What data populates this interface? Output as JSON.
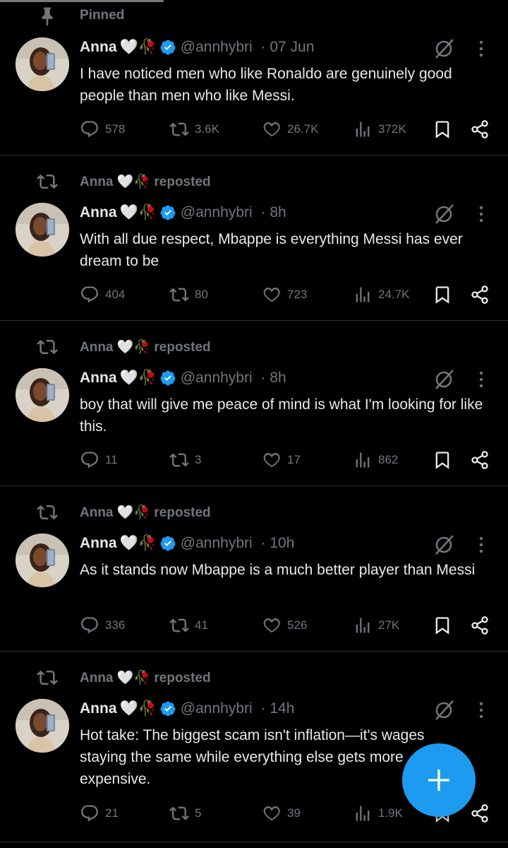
{
  "colors": {
    "background": "#000000",
    "text": "#e7e9ea",
    "muted": "#71767b",
    "accent": "#1d9bf0",
    "divider": "#2f3336"
  },
  "tweets": [
    {
      "context": "Pinned",
      "author": {
        "name": "Anna",
        "emoji": "🤍🥀",
        "handle": "@annhybri",
        "time": "07 Jun"
      },
      "text": "I have noticed men who like Ronaldo are genuinely good people than men who like Messi.",
      "stats": {
        "replies": "578",
        "reposts": "3.6K",
        "likes": "26.7K",
        "views": "372K"
      }
    },
    {
      "context": "Anna 🤍🥀 reposted",
      "author": {
        "name": "Anna",
        "emoji": "🤍🥀",
        "handle": "@annhybri",
        "time": "8h"
      },
      "text": "With all due respect, Mbappe is everything Messi has ever dream to be",
      "stats": {
        "replies": "404",
        "reposts": "80",
        "likes": "723",
        "views": "24.7K"
      }
    },
    {
      "context": "Anna 🤍🥀 reposted",
      "author": {
        "name": "Anna",
        "emoji": "🤍🥀",
        "handle": "@annhybri",
        "time": "8h"
      },
      "text": "boy that will give me peace of mind is what I'm looking for like this.",
      "stats": {
        "replies": "11",
        "reposts": "3",
        "likes": "17",
        "views": "862"
      }
    },
    {
      "context": "Anna 🤍🥀 reposted",
      "author": {
        "name": "Anna",
        "emoji": "🤍🥀",
        "handle": "@annhybri",
        "time": "10h"
      },
      "text": "As it stands now Mbappe is a much better player than Messi",
      "stats": {
        "replies": "336",
        "reposts": "41",
        "likes": "526",
        "views": "27K"
      }
    },
    {
      "context": "Anna 🤍🥀 reposted",
      "author": {
        "name": "Anna",
        "emoji": "🤍🥀",
        "handle": "@annhybri",
        "time": "14h"
      },
      "text": "Hot take: The biggest scam isn't inflation—it's wages staying the same while everything else gets more expensive.",
      "stats": {
        "replies": "21",
        "reposts": "5",
        "likes": "39",
        "views": "1.9K"
      }
    }
  ],
  "fab": {
    "icon": "plus-icon"
  }
}
